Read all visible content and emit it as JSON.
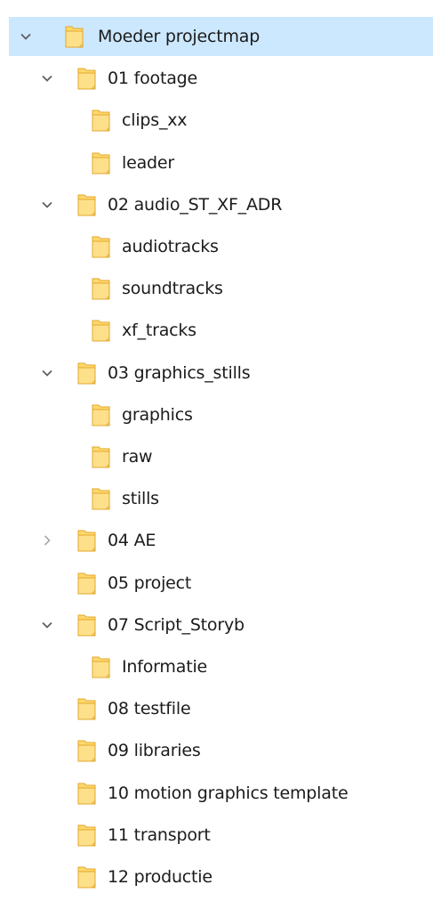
{
  "tree": {
    "colors": {
      "selection": "#cce8ff",
      "folder_body": "#ffd86b",
      "folder_front": "#ffe08a",
      "folder_edge": "#e0a82e",
      "chevron": "#5f5f5f",
      "text": "#1b1b1b"
    },
    "items": [
      {
        "label": "Moeder projectmap",
        "level": 0,
        "expander": "expanded",
        "selected": true,
        "icon": "folder-icon"
      },
      {
        "label": "01 footage",
        "level": 1,
        "expander": "expanded",
        "icon": "folder-icon"
      },
      {
        "label": "clips_xx",
        "level": 2,
        "expander": "none",
        "icon": "folder-icon"
      },
      {
        "label": "leader",
        "level": 2,
        "expander": "none",
        "icon": "folder-icon"
      },
      {
        "label": "02 audio_ST_XF_ADR",
        "level": 1,
        "expander": "expanded",
        "icon": "folder-icon"
      },
      {
        "label": "audiotracks",
        "level": 2,
        "expander": "none",
        "icon": "folder-icon"
      },
      {
        "label": "soundtracks",
        "level": 2,
        "expander": "none",
        "icon": "folder-icon"
      },
      {
        "label": "xf_tracks",
        "level": 2,
        "expander": "none",
        "icon": "folder-icon"
      },
      {
        "label": "03 graphics_stills",
        "level": 1,
        "expander": "expanded",
        "icon": "folder-icon"
      },
      {
        "label": "graphics",
        "level": 2,
        "expander": "none",
        "icon": "folder-icon"
      },
      {
        "label": "raw",
        "level": 2,
        "expander": "none",
        "icon": "folder-icon"
      },
      {
        "label": "stills",
        "level": 2,
        "expander": "none",
        "icon": "folder-icon"
      },
      {
        "label": "04 AE",
        "level": 1,
        "expander": "collapsed",
        "icon": "folder-icon"
      },
      {
        "label": "05 project",
        "level": 1,
        "expander": "none",
        "icon": "folder-icon"
      },
      {
        "label": "07 Script_Storyb",
        "level": 1,
        "expander": "expanded",
        "icon": "folder-icon"
      },
      {
        "label": "Informatie",
        "level": 2,
        "expander": "none",
        "icon": "folder-icon"
      },
      {
        "label": "08 testfile",
        "level": 1,
        "expander": "none",
        "icon": "folder-icon"
      },
      {
        "label": "09 libraries",
        "level": 1,
        "expander": "none",
        "icon": "folder-icon"
      },
      {
        "label": "10 motion graphics template",
        "level": 1,
        "expander": "none",
        "icon": "folder-icon"
      },
      {
        "label": "11 transport",
        "level": 1,
        "expander": "none",
        "icon": "folder-icon"
      },
      {
        "label": "12 productie",
        "level": 1,
        "expander": "none",
        "icon": "folder-icon"
      }
    ]
  }
}
